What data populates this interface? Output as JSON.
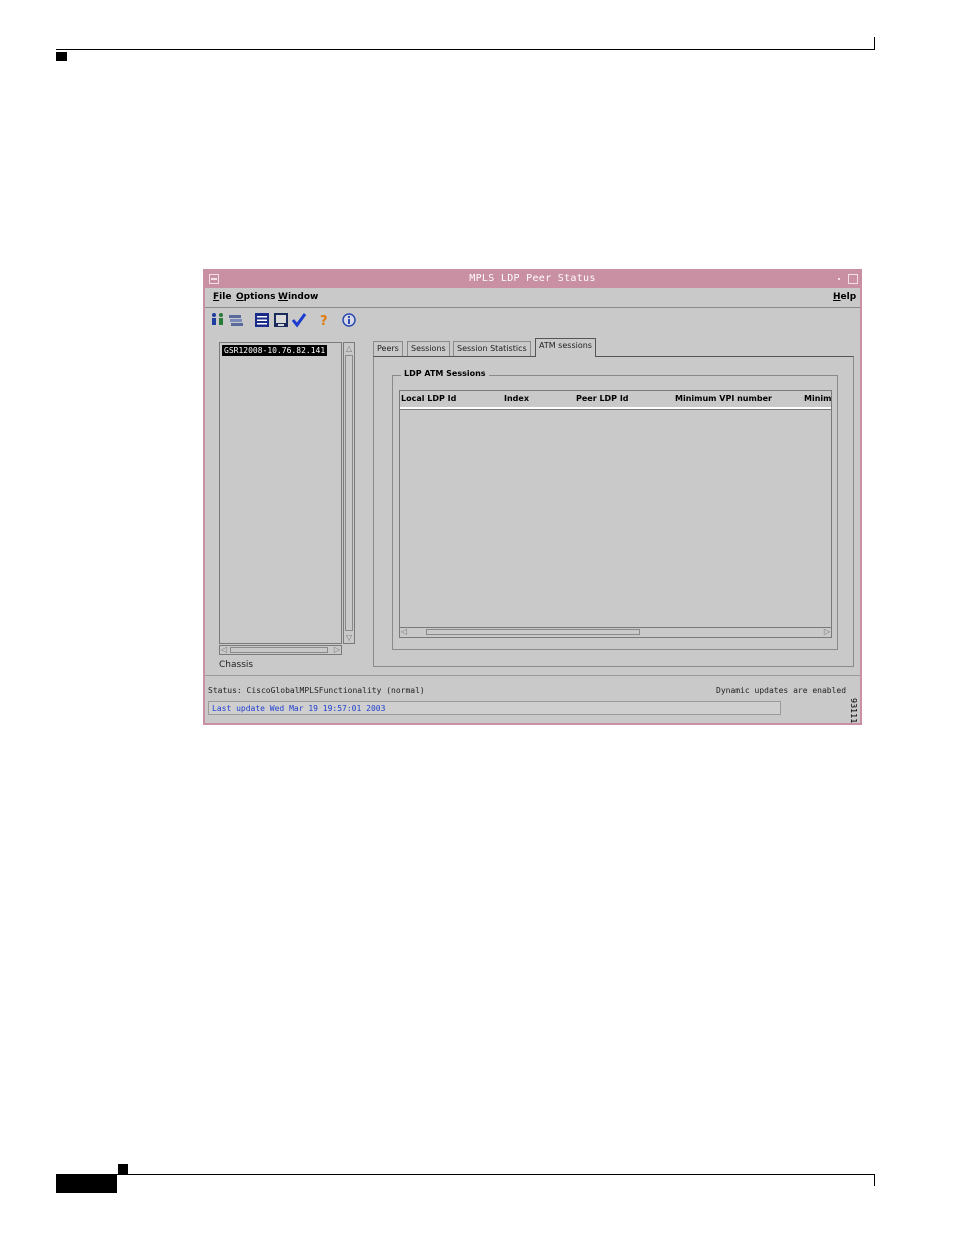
{
  "window": {
    "title": "MPLS LDP Peer Status"
  },
  "menu": {
    "file": "File",
    "options": "Options",
    "window": "Window",
    "help": "Help"
  },
  "toolbar": {
    "icons": [
      "people-icon",
      "network-icon",
      "list-icon",
      "monitor-icon",
      "checkmark-icon",
      "help-icon",
      "info-icon"
    ]
  },
  "device_list": {
    "items": [
      "GSR12008-10.76.82.141"
    ],
    "label": "Chassis"
  },
  "tabs": [
    "Peers",
    "Sessions",
    "Session Statistics",
    "ATM sessions"
  ],
  "active_tab": "ATM sessions",
  "group": {
    "title": "LDP ATM Sessions",
    "columns": [
      "Local LDP Id",
      "Index",
      "Peer LDP Id",
      "Minimum VPI number",
      "Minimu"
    ],
    "rows": []
  },
  "status": {
    "text": "Status: CiscoGlobalMPLSFunctionality (normal)",
    "dynamic": "Dynamic updates are enabled",
    "last_update": "Last update Wed Mar 19 19:57:01 2003"
  },
  "figure_number": "93111",
  "colors": {
    "title_bar": "#c98fa3",
    "window_bg": "#c9c9c9",
    "update_text": "#1f3fd0"
  }
}
